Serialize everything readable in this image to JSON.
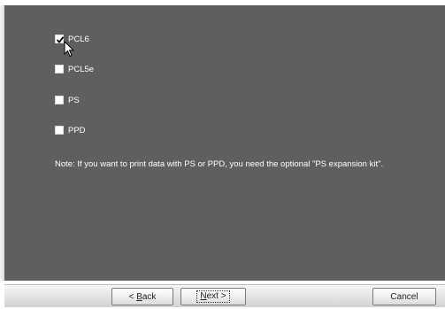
{
  "options": [
    {
      "label": "PCL6",
      "checked": true
    },
    {
      "label": "PCL5e",
      "checked": false
    },
    {
      "label": "PS",
      "checked": false
    },
    {
      "label": "PPD",
      "checked": false
    }
  ],
  "note": "Note: If you want to print data with PS or PPD, you need the optional \"PS expansion kit\".",
  "buttons": {
    "back": {
      "arrow": "< ",
      "accel": "B",
      "rest": "ack"
    },
    "next": {
      "accel": "N",
      "rest": "ext",
      "arrow": " >"
    },
    "cancel": "Cancel"
  },
  "colors": {
    "panel": "#5f5f5f",
    "text": "#ffffff"
  },
  "icons": {
    "cursor": "mouse-pointer-icon",
    "check": "checkmark-icon"
  }
}
